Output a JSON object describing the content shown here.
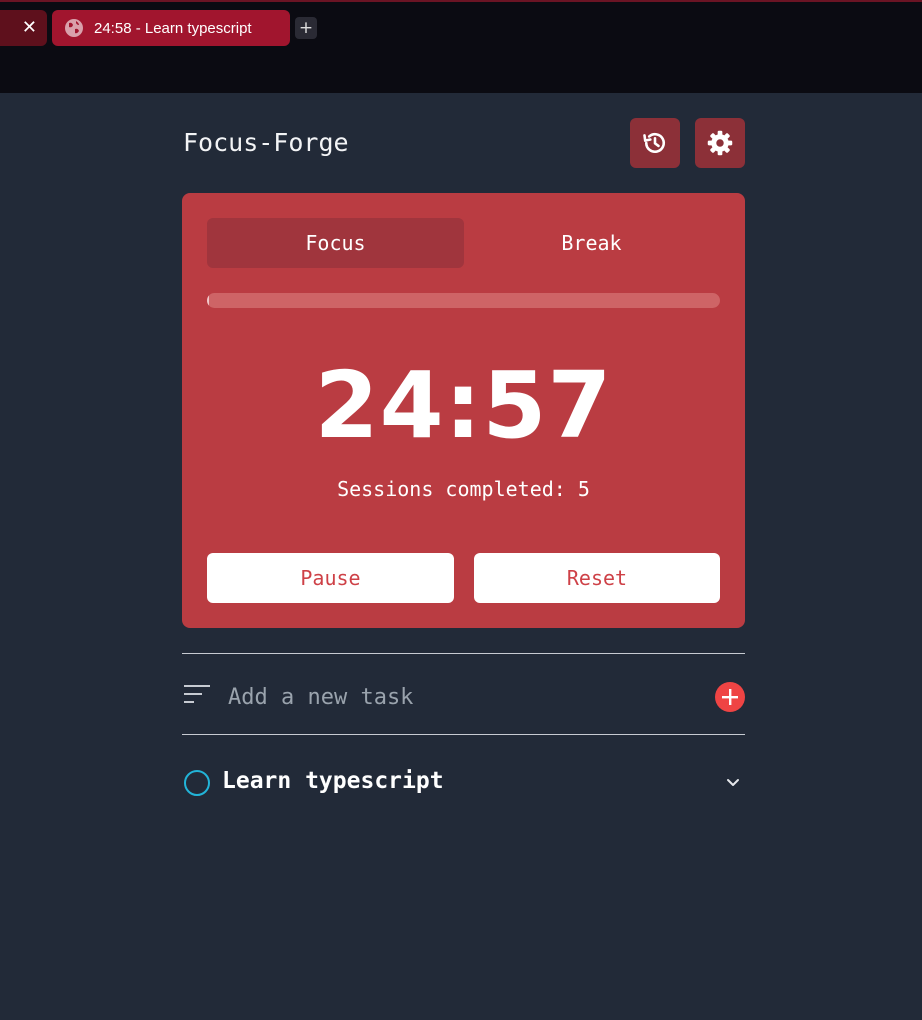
{
  "browser": {
    "prev_tab_fragment": "...",
    "active_tab_title": "24:58 - Learn typescript",
    "new_tab_label": "+",
    "close_label": "✕"
  },
  "app": {
    "title": "Focus-Forge",
    "icons": {
      "history": "history-icon",
      "settings": "gear-icon"
    }
  },
  "timer": {
    "modes": [
      "Focus",
      "Break"
    ],
    "active_mode": "Focus",
    "progress_fraction": 0.003,
    "time": "24:57",
    "sessions_text": "Sessions completed: 5",
    "pause_label": "Pause",
    "reset_label": "Reset"
  },
  "tasks": {
    "input_placeholder": "Add a new task",
    "items": [
      {
        "title": "Learn typescript",
        "completed": false
      }
    ]
  },
  "colors": {
    "page_bg": "#222a38",
    "card": "#ba3c42",
    "accent": "#ef4444",
    "checkbox": "#22b4d8"
  }
}
